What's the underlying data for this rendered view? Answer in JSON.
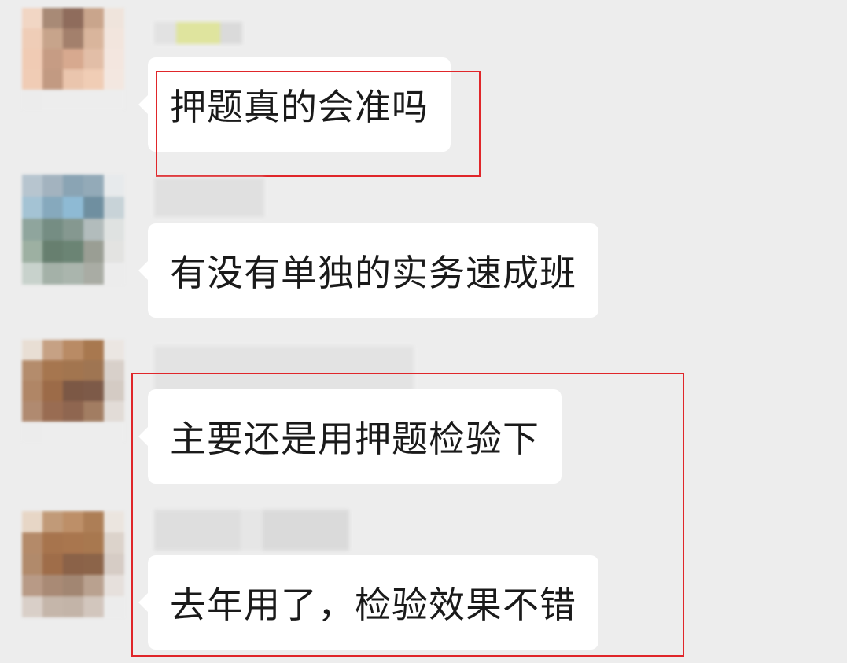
{
  "messages": [
    {
      "text": "押题真的会准吗"
    },
    {
      "text": "有没有单独的实务速成班"
    },
    {
      "text": "主要还是用押题检验下"
    },
    {
      "text": "去年用了，检验效果不错"
    }
  ],
  "colors": {
    "background": "#ededed",
    "bubble": "#ffffff",
    "highlight_border": "#e0262a",
    "text": "#1a1a1a"
  }
}
